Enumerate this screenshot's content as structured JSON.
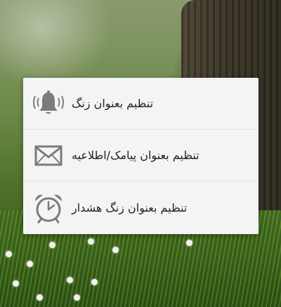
{
  "dialog": {
    "options": [
      {
        "label": "تنظیم بعنوان زنگ",
        "icon": "ringing-bell-icon"
      },
      {
        "label": "تنظیم بعنوان پیامک/اطلاعیه",
        "icon": "envelope-icon"
      },
      {
        "label": "تنظیم بعنوان زنگ هشدار",
        "icon": "alarm-clock-icon"
      }
    ]
  },
  "colors": {
    "dialog_background": "#f4f4f4",
    "icon_gray": "#7b7b7b",
    "text": "#222222"
  }
}
